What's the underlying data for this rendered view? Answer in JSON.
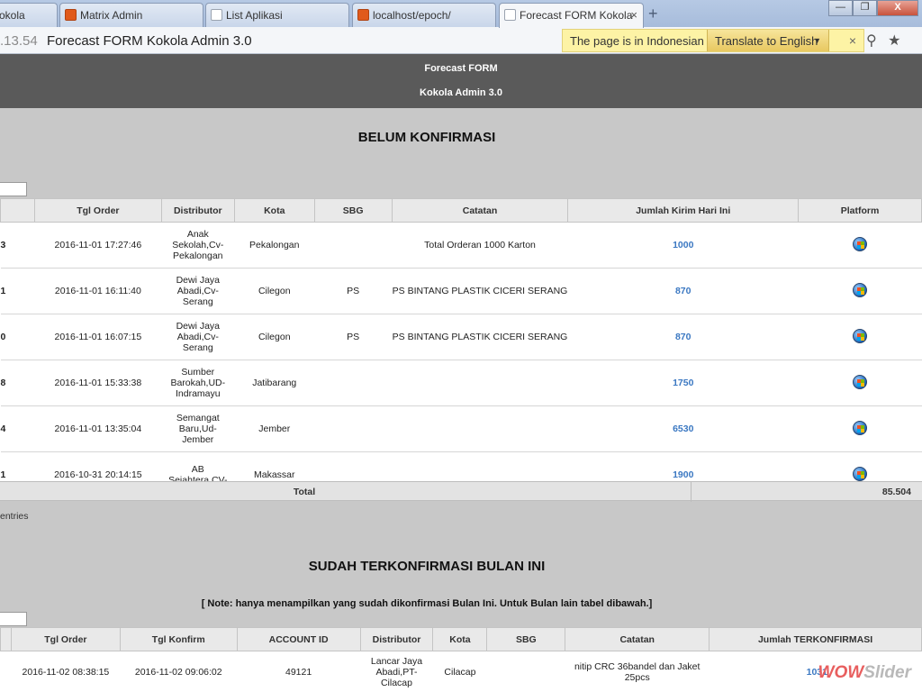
{
  "browser": {
    "tabs": [
      {
        "label": "kokola",
        "icon": "xampp-icon",
        "active": false
      },
      {
        "label": "Matrix Admin",
        "icon": "xampp-icon",
        "active": false
      },
      {
        "label": "List Aplikasi",
        "icon": "page-icon",
        "active": false
      },
      {
        "label": "localhost/epoch/",
        "icon": "xampp-icon",
        "active": false
      },
      {
        "label": "Forecast FORM Kokola",
        "icon": "page-icon",
        "active": true
      }
    ],
    "new_tab": "+",
    "close_glyph": "×",
    "address_host": ".13.54",
    "address_title": "Forecast FORM Kokola Admin 3.0",
    "translate_bar": {
      "message": "The page is in Indonesian",
      "button": "Translate to English",
      "dropdown_glyph": "▼",
      "close_glyph": "×"
    },
    "window_buttons": {
      "minimize": "—",
      "maximize": "❐",
      "close": "X"
    },
    "address_icons": {
      "search": "⚲",
      "star": "★"
    }
  },
  "header": {
    "line1": "Forecast FORM",
    "line2": "Kokola Admin 3.0"
  },
  "section1": {
    "title": "BELUM KONFIRMASI",
    "columns": [
      "Tgl Order",
      "Distributor",
      "Kota",
      "SBG",
      "Catatan",
      "Jumlah Kirim Hari Ini",
      "Platform"
    ],
    "rows": [
      {
        "id": "3",
        "tgl_order": "2016-11-01 17:27:46",
        "distributor": "Anak Sekolah,Cv-Pekalongan",
        "kota": "Pekalongan",
        "sbg": "",
        "catatan": "Total Orderan 1000 Karton",
        "jumlah": "1000",
        "platform": "windows-icon"
      },
      {
        "id": "1",
        "tgl_order": "2016-11-01 16:11:40",
        "distributor": "Dewi Jaya Abadi,Cv-Serang",
        "kota": "Cilegon",
        "sbg": "PS",
        "catatan": "PS BINTANG PLASTIK CICERI SERANG",
        "jumlah": "870",
        "platform": "windows-icon"
      },
      {
        "id": "0",
        "tgl_order": "2016-11-01 16:07:15",
        "distributor": "Dewi Jaya Abadi,Cv-Serang",
        "kota": "Cilegon",
        "sbg": "PS",
        "catatan": "PS BINTANG PLASTIK CICERI SERANG",
        "jumlah": "870",
        "platform": "windows-icon"
      },
      {
        "id": "8",
        "tgl_order": "2016-11-01 15:33:38",
        "distributor": "Sumber Barokah,UD-Indramayu",
        "kota": "Jatibarang",
        "sbg": "",
        "catatan": "",
        "jumlah": "1750",
        "platform": "windows-icon"
      },
      {
        "id": "4",
        "tgl_order": "2016-11-01 13:35:04",
        "distributor": "Semangat Baru,Ud-Jember",
        "kota": "Jember",
        "sbg": "",
        "catatan": "",
        "jumlah": "6530",
        "platform": "windows-icon"
      },
      {
        "id": "1",
        "tgl_order": "2016-10-31 20:14:15",
        "distributor": "AB Sejahtera,CV-",
        "kota": "Makassar",
        "sbg": "",
        "catatan": "",
        "jumlah": "1900",
        "platform": "windows-icon"
      }
    ],
    "total_label": "Total",
    "total_value": "85.504",
    "entries_text": "entries"
  },
  "section2": {
    "title": "SUDAH TERKONFIRMASI BULAN INI",
    "note": "[ Note: hanya menampilkan yang sudah dikonfirmasi Bulan Ini. Untuk Bulan lain tabel dibawah.]",
    "columns": [
      "Tgl Order",
      "Tgl Konfirm",
      "ACCOUNT ID",
      "Distributor",
      "Kota",
      "SBG",
      "Catatan",
      "Jumlah TERKONFIRMASI"
    ],
    "rows": [
      {
        "tgl_order": "2016-11-02 08:38:15",
        "tgl_konfirm": "2016-11-02 09:06:02",
        "account_id": "49121",
        "distributor": "Lancar Jaya Abadi,PT-Cilacap",
        "kota": "Cilacap",
        "sbg": "",
        "catatan": "nitip CRC 36bandel dan Jaket 25pcs",
        "jumlah": "1031"
      }
    ]
  },
  "watermark": {
    "part1": "WOW",
    "part2": "Slider"
  }
}
